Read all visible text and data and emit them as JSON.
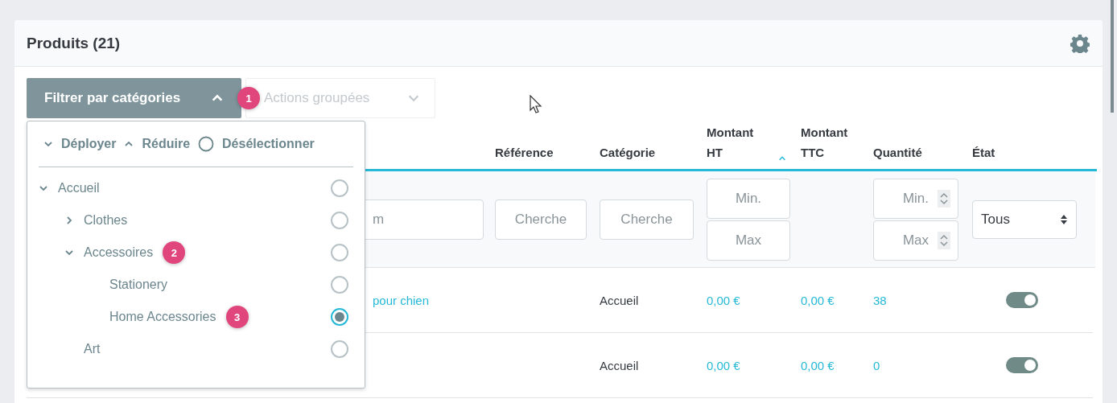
{
  "panel": {
    "title": "Produits (21)"
  },
  "toolbar": {
    "filter_button": {
      "label": "Filtrer par catégories",
      "expanded": true,
      "step_badge": "1"
    },
    "bulk_button": {
      "label": "Actions groupées",
      "disabled": true
    }
  },
  "category_dropdown": {
    "actions": [
      {
        "kind": "expand",
        "label": "Déployer"
      },
      {
        "kind": "collapse",
        "label": "Réduire"
      },
      {
        "kind": "deselect",
        "label": "Désélectionner"
      }
    ],
    "tree": [
      {
        "label": "Accueil",
        "expanded": true,
        "selected": false,
        "children": [
          {
            "label": "Clothes",
            "expanded": false,
            "selected": false
          },
          {
            "label": "Accessoires",
            "expanded": true,
            "selected": false,
            "step_badge": "2",
            "children": [
              {
                "label": "Stationery",
                "selected": false
              },
              {
                "label": "Home Accessories",
                "selected": true,
                "step_badge": "3"
              }
            ]
          },
          {
            "label": "Art",
            "selected": false
          }
        ]
      }
    ]
  },
  "table": {
    "columns": [
      {
        "filter": {
          "kind": "text",
          "placeholder": "m"
        }
      },
      {
        "label": "Référence",
        "filter": {
          "kind": "text",
          "placeholder": "Cherche"
        }
      },
      {
        "label": "Catégorie",
        "filter": {
          "kind": "text",
          "placeholder": "Cherche"
        }
      },
      {
        "label": "Montant HT",
        "sorted": true,
        "filter": {
          "kind": "range",
          "min_placeholder": "Min.",
          "max_placeholder": "Max"
        }
      },
      {
        "label": "Montant TTC"
      },
      {
        "label": "Quantité",
        "filter": {
          "kind": "spin_range",
          "min_placeholder": "Min.",
          "max_placeholder": "Max"
        }
      },
      {
        "label": "État",
        "filter": {
          "kind": "select",
          "value": "Tous"
        }
      }
    ],
    "rows": [
      {
        "name": "pour chien",
        "category": "Accueil",
        "price_ht": "0,00 €",
        "price_ttc": "0,00 €",
        "quantity": "38",
        "active": true
      },
      {
        "category": "Accueil",
        "price_ht": "0,00 €",
        "price_ttc": "0,00 €",
        "quantity": "0",
        "active": true
      }
    ]
  }
}
